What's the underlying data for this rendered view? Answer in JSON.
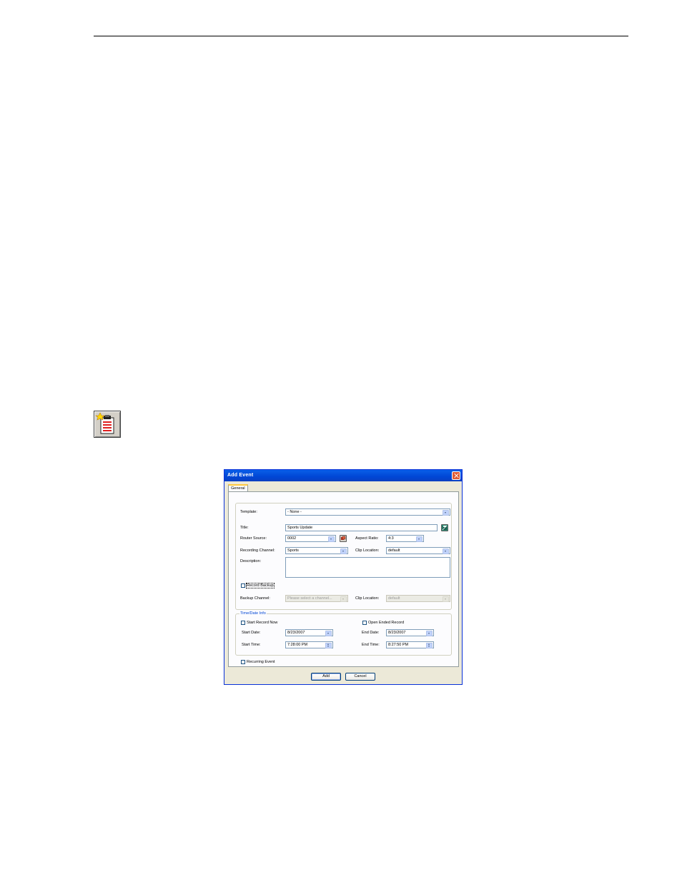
{
  "dialog": {
    "title": "Add Event",
    "tab": "General",
    "template": {
      "label": "Template:",
      "value": "- None -"
    },
    "title_field": {
      "label": "Title:",
      "value": "Sports Update"
    },
    "router_source": {
      "label": "Router Source:",
      "value": "0002"
    },
    "aspect_ratio": {
      "label": "Aspect Ratio:",
      "value": "4:3"
    },
    "recording_channel": {
      "label": "Recording Channel:",
      "value": "Sports"
    },
    "clip_location": {
      "label": "Clip Location:",
      "value": "default"
    },
    "description": {
      "label": "Description:",
      "value": ""
    },
    "record_backup": {
      "label": "Record Backup",
      "checked": false
    },
    "backup_channel": {
      "label": "Backup Channel:",
      "value": "Please select a channel..."
    },
    "backup_clip_location": {
      "label": "Clip Location:",
      "value": "default"
    },
    "time_date": {
      "legend": "Time/Date Info",
      "start_now": {
        "label": "Start Record Now",
        "checked": false
      },
      "open_ended": {
        "label": "Open Ended Record",
        "checked": false
      },
      "start_date": {
        "label": "Start Date:",
        "value": "8/23/2007"
      },
      "end_date": {
        "label": "End Date:",
        "value": "8/23/2007"
      },
      "start_time": {
        "label": "Start Time:",
        "value": "7:28:00 PM"
      },
      "end_time": {
        "label": "End Time:",
        "value": "8:27:50 PM"
      }
    },
    "recurring": {
      "label": "Recurring Event",
      "checked": false
    },
    "buttons": {
      "add": "Add",
      "cancel": "Cancel"
    }
  },
  "colors": {
    "titlebar": "#0054e3",
    "accent": "#0046d5",
    "close": "#e05a34",
    "dialog_bg": "#ece9d8"
  },
  "icons": [
    "add-event-toolbar-icon",
    "close-icon",
    "save-template-icon",
    "router-source-icon",
    "chevron-down-icon",
    "spinner-icon"
  ]
}
